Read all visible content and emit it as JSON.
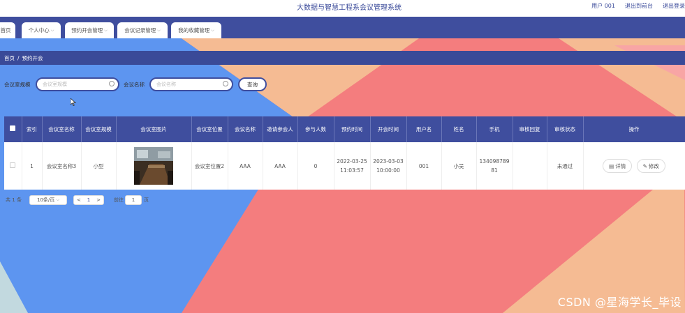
{
  "header": {
    "title": "大数据与智慧工程系会议管理系统",
    "user_label": "用户",
    "user_name": "001",
    "back_link": "退出到前台",
    "logout_link": "退出登录"
  },
  "nav": {
    "items": [
      "首页",
      "个人中心",
      "预约开会管理",
      "会议记录管理",
      "我的收藏管理"
    ]
  },
  "breadcrumb": {
    "home": "首页",
    "sep": "/",
    "current": "预约开会"
  },
  "search": {
    "room_label": "会议室规模",
    "room_placeholder": "会议室规模",
    "name_label": "会议名称",
    "name_placeholder": "会议名称",
    "query_button": "查询"
  },
  "table": {
    "headers": [
      "索引",
      "会议室名称",
      "会议室规模",
      "会议室图片",
      "会议室位置",
      "会议名称",
      "邀请参会人",
      "参与人数",
      "预约时间",
      "开会时间",
      "用户名",
      "姓名",
      "手机",
      "审核回复",
      "审核状态",
      "操作"
    ],
    "rows": [
      {
        "index": "1",
        "room_name": "会议室名称3",
        "room_size": "小型",
        "room_location": "会议室位置2",
        "meeting_name": "AAA",
        "invitees": "AAA",
        "participants": "0",
        "booking_time": "2022-03-25 11:03:57",
        "meeting_time": "2023-03-03 10:00:00",
        "username": "001",
        "name": "小吴",
        "phone": "13409878981",
        "review_reply": "",
        "review_status": "未通过",
        "detail_label": "详情",
        "edit_label": "修改"
      }
    ]
  },
  "pagination": {
    "total_prefix": "共",
    "total": "1",
    "total_suffix": "条",
    "page_size": "10条/页",
    "prev": "<",
    "current_page": "1",
    "next": ">",
    "goto_prefix": "前往",
    "goto_value": "1",
    "goto_suffix": "页"
  },
  "watermark": "CSDN @星海学长_毕设",
  "colors": {
    "primary": "#3f4e9e",
    "bg_blue": "#5d95f0",
    "bg_peach": "#f5bb93",
    "bg_red": "#f47d7e",
    "bg_light": "#c2d9df"
  }
}
